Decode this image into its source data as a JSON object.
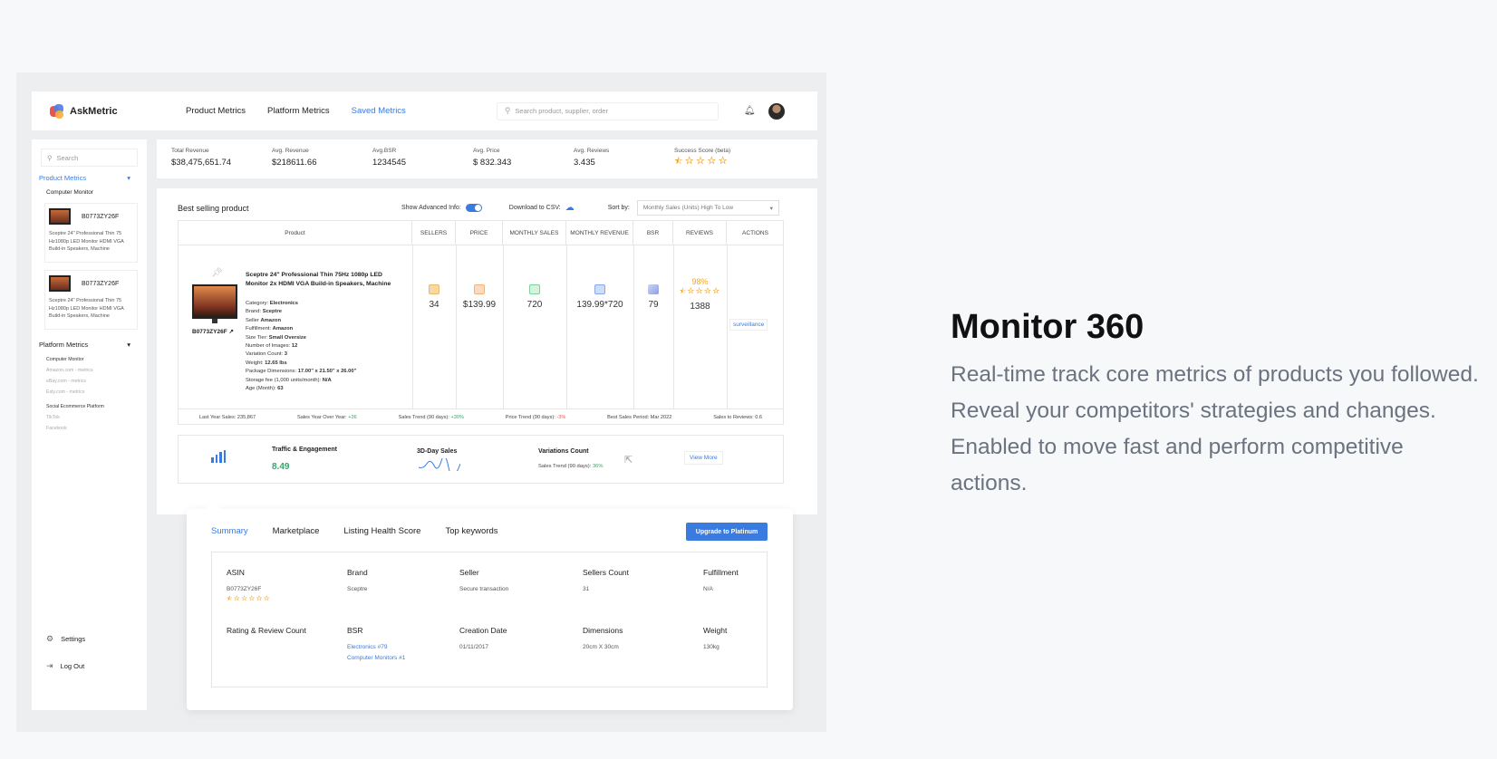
{
  "topbar": {
    "brand": "AskMetric",
    "nav": [
      "Product Metrics",
      "Platform Metrics",
      "Saved Metrics"
    ],
    "search_placeholder": "Search product, supplier, order"
  },
  "sidebar": {
    "search_placeholder": "Search",
    "section_product": "Product Metrics",
    "sub_computer_monitor": "Computer Monitor",
    "products": [
      {
        "asin": "B0773ZY26F",
        "desc": "Sceptre 24\" Professional Thin 75 Hz1080p LED Monitor HDMI VGA Build-in Speakers, Machine"
      },
      {
        "asin": "B0773ZY26F",
        "desc": "Sceptre 24\" Professional Thin 75 Hz1080p LED Monitor HDMI VGA Build-in Speakers, Machine"
      }
    ],
    "section_platform": "Platform Metrics",
    "platform_items": [
      "Computer Monitor",
      "Amazon.com - metrics",
      "eBay.com - metrics",
      "Esty.com - metrics",
      "Social Ecommerce Platform",
      "TikTok",
      "Facebook"
    ],
    "settings": "Settings",
    "logout": "Log Out"
  },
  "stats": [
    {
      "label": "Total Revenue",
      "value": "$38,475,651.74"
    },
    {
      "label": "Avg. Revenue",
      "value": "$218611.66"
    },
    {
      "label": "Avg.BSR",
      "value": "1234545"
    },
    {
      "label": "Avg. Price",
      "value": "$ 832.343"
    },
    {
      "label": "Avg. Reviews",
      "value": "3.435"
    },
    {
      "label": "Success Score (beta)",
      "value": ""
    }
  ],
  "main": {
    "title": "Best selling product",
    "advanced_label": "Show Advanced Info:",
    "csv_label": "Download to CSV:",
    "sort_label": "Sort by:",
    "sort_value": "Monthly Sales (Units) High To Low",
    "columns": [
      "Product",
      "SELLERS",
      "PRICE",
      "MONTHLY SALES",
      "MONTHLY REVENUE",
      "BSR",
      "REVIEWS",
      "ACTIONS"
    ],
    "product": {
      "asin": "B0773ZY26F",
      "title": "Sceptre 24\" Professional Thin 75Hz 1080p LED Monitor 2x HDMI VGA Build-in Speakers, Machine",
      "attrs": [
        [
          "Category: ",
          "Electronics"
        ],
        [
          "Brand: ",
          "Sceptre"
        ],
        [
          "Seller ",
          "Amazon"
        ],
        [
          "Fulfillment: ",
          "Amazon"
        ],
        [
          "Size Tier: ",
          "Small Oversize"
        ],
        [
          "Number of Images: ",
          "12"
        ],
        [
          "Variation Count: ",
          "3"
        ],
        [
          "Weight: ",
          "12.65 lbs"
        ],
        [
          "Package Dimensions: ",
          "17.00\" x 21.50\" x 26.00\""
        ],
        [
          "Storage fee (1,000 units/month): ",
          "N/A"
        ],
        [
          "Age (Month): ",
          "63"
        ]
      ],
      "sellers": "34",
      "price": "$139.99",
      "monthly_sales": "720",
      "monthly_revenue": "139.99*720",
      "bsr": "79",
      "review_pct": "98%",
      "reviews": "1388",
      "action": "surveillance"
    },
    "footer": {
      "last_year": "Last Year Sales: 235,867",
      "yoy_label": "Sales Year Over Year: ",
      "yoy_val": "+36",
      "sales_trend_label": "Sales Trend (90 days): ",
      "sales_trend_val": "+30%",
      "price_trend_label": "Price Trend (90 days): ",
      "price_trend_val": "-3%",
      "best_period": "Best Sales Period: Mar 2022",
      "sales_to_reviews": "Sales to Reviews: 0.6"
    },
    "traffic": {
      "label": "Traffic & Engagement",
      "value": "8.49",
      "sales_label": "3D-Day Sales",
      "variations_label": "Variations Count",
      "variations_trend_label": "Sales Trend (90 days): ",
      "variations_trend_val": "36%",
      "view_more": "View More"
    }
  },
  "popup": {
    "tabs": [
      "Summary",
      "Marketplace",
      "Listing Health Score",
      "Top keywords"
    ],
    "upgrade": "Upgrade to Platinum",
    "fields": {
      "asin": {
        "k": "ASIN",
        "v": "B0773ZY26F"
      },
      "brand": {
        "k": "Brand",
        "v": "Sceptre"
      },
      "seller": {
        "k": "Seller",
        "v": "Secure transaction"
      },
      "sellers_count": {
        "k": "Sellers Count",
        "v": "31"
      },
      "fulfillment": {
        "k": "Fulfillment",
        "v": "N/A"
      },
      "rating": {
        "k": "Rating & Review Count",
        "v": ""
      },
      "bsr": {
        "k": "BSR",
        "v1": "Electronics #79",
        "v2": "Computer Monitors #1"
      },
      "creation": {
        "k": "Creation Date",
        "v": "01/11/2017"
      },
      "dimensions": {
        "k": "Dimensions",
        "v": "20cm X 30cm"
      },
      "weight": {
        "k": "Weight",
        "v": "130kg"
      }
    }
  },
  "hero": {
    "title": "Monitor 360",
    "body": "Real-time track core metrics of products you followed. Reveal your competitors' strategies and changes. Enabled to move fast and perform competitive actions."
  },
  "colors": {
    "accent": "#3a7be0",
    "star": "#f0a52a",
    "positive": "#3aa56a",
    "negative": "#e0564a"
  }
}
